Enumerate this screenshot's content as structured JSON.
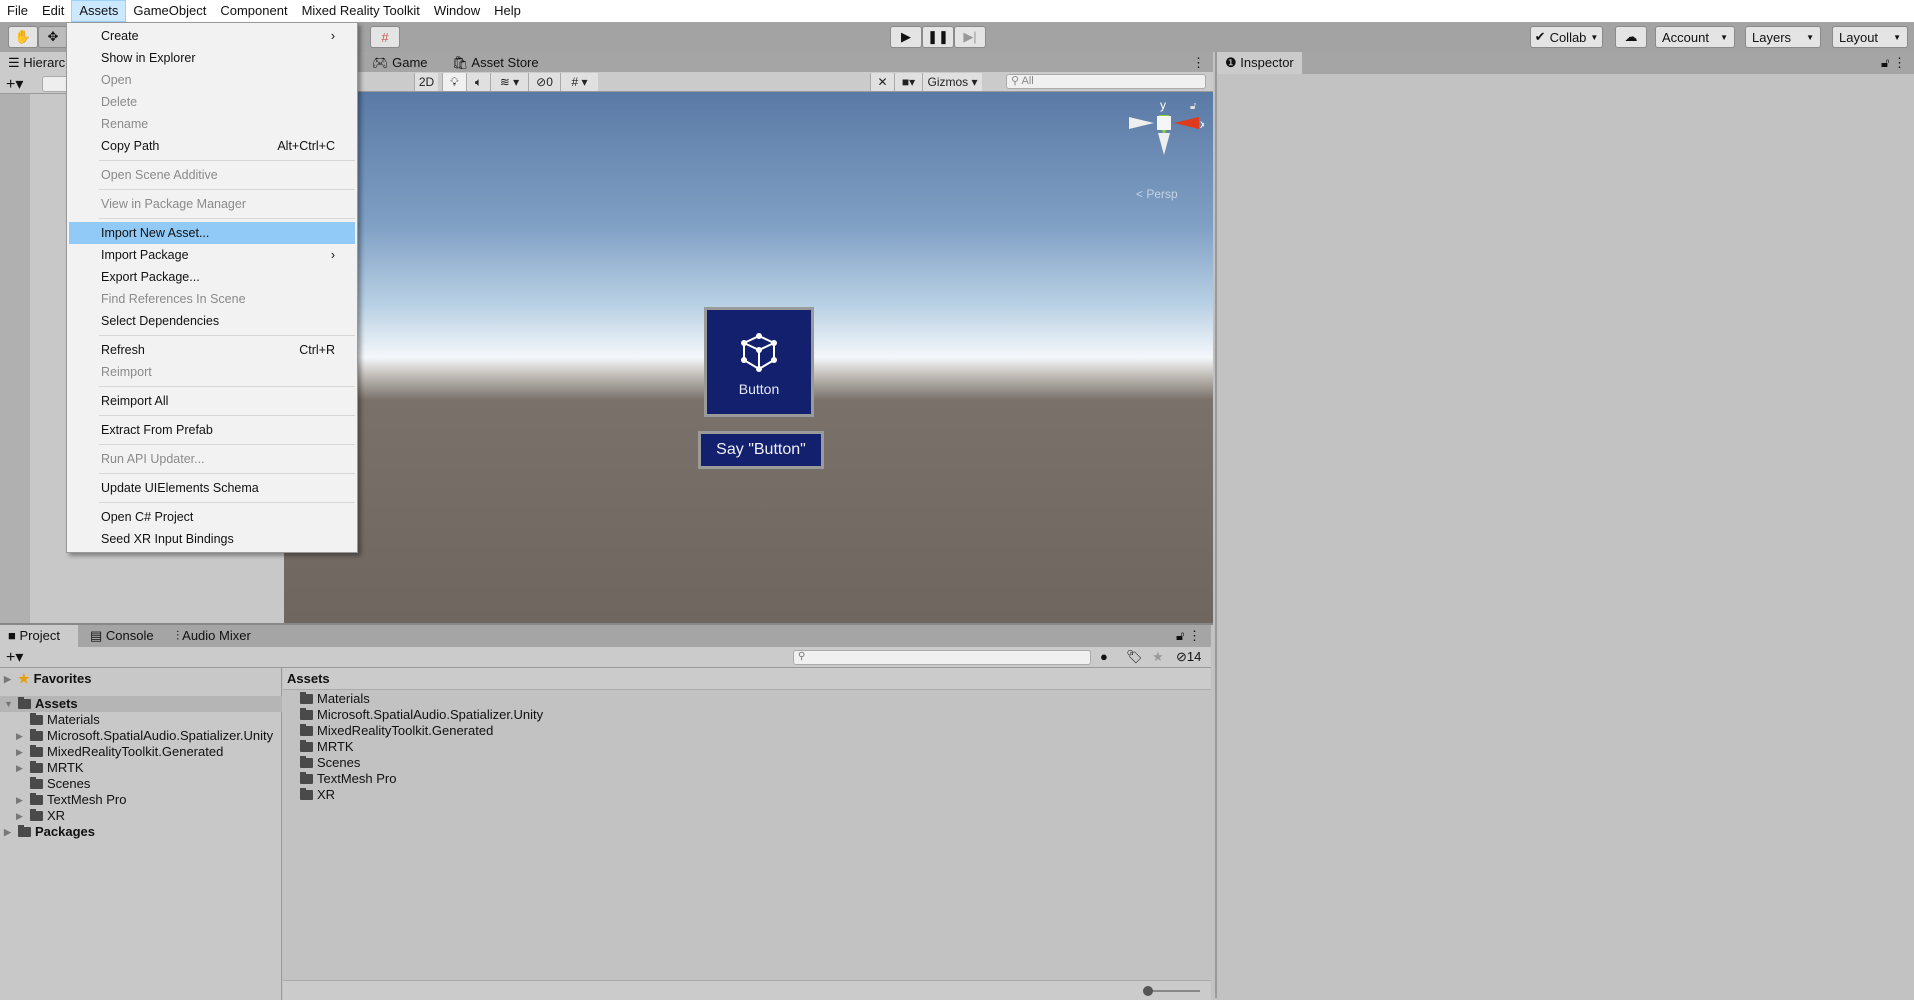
{
  "menubar": [
    "File",
    "Edit",
    "Assets",
    "GameObject",
    "Component",
    "Mixed Reality Toolkit",
    "Window",
    "Help"
  ],
  "toolbar": {
    "collab": "Collab",
    "account": "Account",
    "layers": "Layers",
    "layout": "Layout"
  },
  "hierarchy": {
    "tab": "Hierarchy"
  },
  "scene": {
    "tabs": [
      "Game",
      "Asset Store"
    ],
    "mode_2d": "2D",
    "hidden_count": "0",
    "gizmos": "Gizmos",
    "search_placeholder": "All",
    "persp": "Persp",
    "axis_x": "x",
    "axis_y": "y",
    "button_label": "Button",
    "say_button_label": "Say \"Button\""
  },
  "inspector": {
    "tab": "Inspector"
  },
  "assets_menu": {
    "items": [
      {
        "label": "Create",
        "submenu": true
      },
      {
        "label": "Show in Explorer"
      },
      {
        "label": "Open",
        "disabled": true
      },
      {
        "label": "Delete",
        "disabled": true
      },
      {
        "label": "Rename",
        "disabled": true
      },
      {
        "label": "Copy Path",
        "shortcut": "Alt+Ctrl+C"
      },
      {
        "sep": true
      },
      {
        "label": "Open Scene Additive",
        "disabled": true
      },
      {
        "sep": true
      },
      {
        "label": "View in Package Manager",
        "disabled": true
      },
      {
        "sep": true
      },
      {
        "label": "Import New Asset...",
        "highlighted": true
      },
      {
        "label": "Import Package",
        "submenu": true
      },
      {
        "label": "Export Package..."
      },
      {
        "label": "Find References In Scene",
        "disabled": true
      },
      {
        "label": "Select Dependencies"
      },
      {
        "sep": true
      },
      {
        "label": "Refresh",
        "shortcut": "Ctrl+R"
      },
      {
        "label": "Reimport",
        "disabled": true
      },
      {
        "sep": true
      },
      {
        "label": "Reimport All"
      },
      {
        "sep": true
      },
      {
        "label": "Extract From Prefab"
      },
      {
        "sep": true
      },
      {
        "label": "Run API Updater...",
        "disabled": true
      },
      {
        "sep": true
      },
      {
        "label": "Update UIElements Schema"
      },
      {
        "sep": true
      },
      {
        "label": "Open C# Project"
      },
      {
        "label": "Seed XR Input Bindings"
      }
    ]
  },
  "project": {
    "tabs": [
      "Project",
      "Console",
      "Audio Mixer"
    ],
    "hidden_count": "14",
    "favorites": "Favorites",
    "assets": "Assets",
    "packages": "Packages",
    "tree": [
      {
        "name": "Materials",
        "expandable": false
      },
      {
        "name": "Microsoft.SpatialAudio.Spatializer.Unity",
        "expandable": true
      },
      {
        "name": "MixedRealityToolkit.Generated",
        "expandable": true
      },
      {
        "name": "MRTK",
        "expandable": true
      },
      {
        "name": "Scenes",
        "expandable": false
      },
      {
        "name": "TextMesh Pro",
        "expandable": true
      },
      {
        "name": "XR",
        "expandable": true
      }
    ],
    "list_header": "Assets",
    "list": [
      "Materials",
      "Microsoft.SpatialAudio.Spatializer.Unity",
      "MixedRealityToolkit.Generated",
      "MRTK",
      "Scenes",
      "TextMesh Pro",
      "XR"
    ]
  }
}
